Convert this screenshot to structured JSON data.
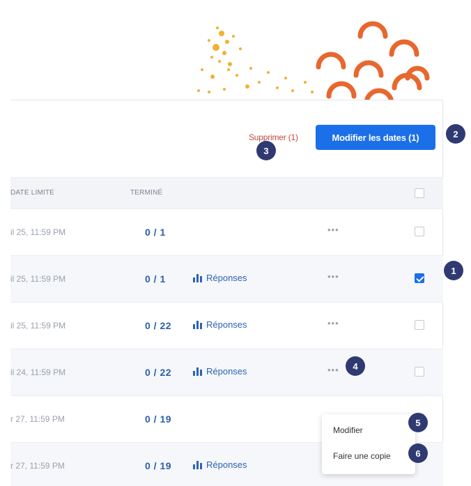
{
  "toolbar": {
    "delete_label": "Supprimer (1)",
    "edit_dates_label": "Modifier les dates (1)"
  },
  "table": {
    "headers": {
      "due_date": "DATE LIMITE",
      "done": "TERMINÉ"
    },
    "rows": [
      {
        "date": "il 25, 11:59 PM",
        "done": "0 / 1",
        "responses": "",
        "checked": false
      },
      {
        "date": "il 25, 11:59 PM",
        "done": "0 / 1",
        "responses": "Réponses",
        "checked": true
      },
      {
        "date": "il 25, 11:59 PM",
        "done": "0 / 22",
        "responses": "Réponses",
        "checked": false
      },
      {
        "date": "il 24, 11:59 PM",
        "done": "0 / 22",
        "responses": "Réponses",
        "checked": false
      },
      {
        "date": "r 27, 11:59 PM",
        "done": "0 / 19",
        "responses": "",
        "checked": false
      },
      {
        "date": "r 27, 11:59 PM",
        "done": "0 / 19",
        "responses": "Réponses",
        "checked": false
      }
    ],
    "more_label": "•••"
  },
  "menu": {
    "edit_label": "Modifier",
    "copy_label": "Faire une copie"
  },
  "badges": [
    "1",
    "2",
    "3",
    "4",
    "5",
    "6"
  ],
  "icons": {
    "responses": "bar-chart-icon",
    "more": "more-dots-icon",
    "checkbox": "checkbox-icon"
  },
  "colors": {
    "primary": "#1b6fe8",
    "link": "#2e62b5",
    "delete": "#c0493f",
    "badge": "#2f3a73",
    "decor_orange": "#e8672f",
    "decor_yellow": "#f0a81c"
  }
}
